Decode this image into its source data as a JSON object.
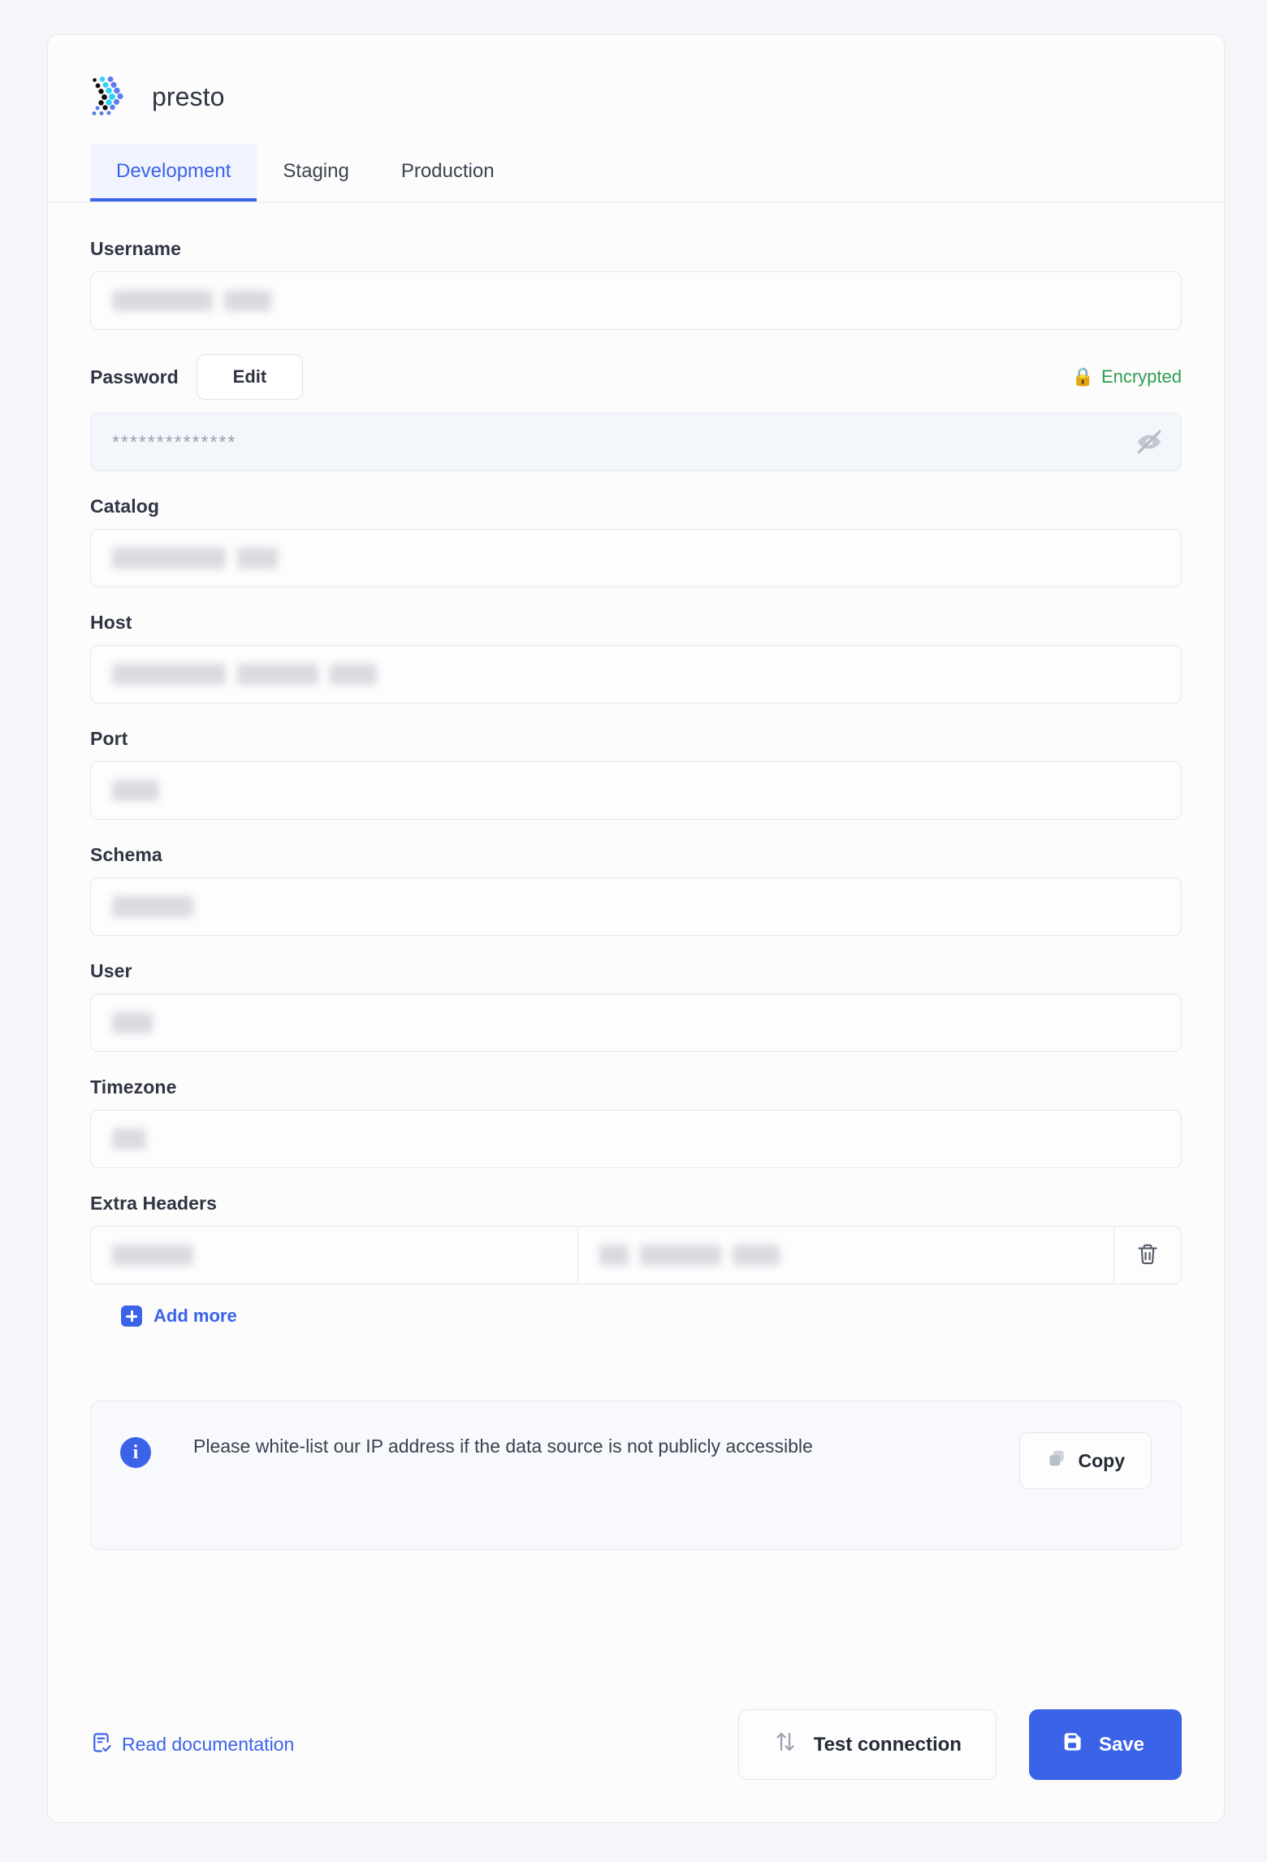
{
  "brand": {
    "name": "presto",
    "logo_icon": "presto-dots-logo"
  },
  "tabs": [
    {
      "label": "Development",
      "active": true
    },
    {
      "label": "Staging",
      "active": false
    },
    {
      "label": "Production",
      "active": false
    }
  ],
  "form": {
    "username": {
      "label": "Username",
      "value": "",
      "redacted": true
    },
    "password": {
      "label": "Password",
      "edit_label": "Edit",
      "encrypted_label": "Encrypted",
      "lock_icon": "lock-icon",
      "lock_glyph": "🔒",
      "masked_value": "**************",
      "toggle_icon": "eye-off-icon"
    },
    "catalog": {
      "label": "Catalog",
      "value": "",
      "redacted": true
    },
    "host": {
      "label": "Host",
      "value": "",
      "redacted": true
    },
    "port": {
      "label": "Port",
      "value": "",
      "redacted": true
    },
    "schema": {
      "label": "Schema",
      "value": "",
      "redacted": true
    },
    "user": {
      "label": "User",
      "value": "",
      "redacted": true
    },
    "timezone": {
      "label": "Timezone",
      "value": "",
      "redacted": true
    },
    "extra_headers": {
      "label": "Extra Headers",
      "rows": [
        {
          "key": "",
          "value": "",
          "redacted": true,
          "delete_icon": "trash-icon"
        }
      ],
      "add_more_label": "Add more",
      "add_more_icon": "plus-square-icon"
    }
  },
  "banner": {
    "info_icon": "info-icon",
    "info_glyph": "i",
    "text": "Please white-list our IP address if the data source is not publicly accessible",
    "copy_label": "Copy",
    "copy_icon": "copy-icon"
  },
  "footer": {
    "doc_link_label": "Read documentation",
    "doc_link_icon": "document-check-icon",
    "test_label": "Test connection",
    "test_icon": "arrows-up-down-icon",
    "save_label": "Save",
    "save_icon": "floppy-disk-icon"
  },
  "colors": {
    "accent": "#3b63e8",
    "page_bg": "#f4f6f9",
    "card_bg": "#fcfcfd",
    "border": "#e6e8ec",
    "text": "#2f3542",
    "encrypted_green": "#2e9e4f"
  }
}
